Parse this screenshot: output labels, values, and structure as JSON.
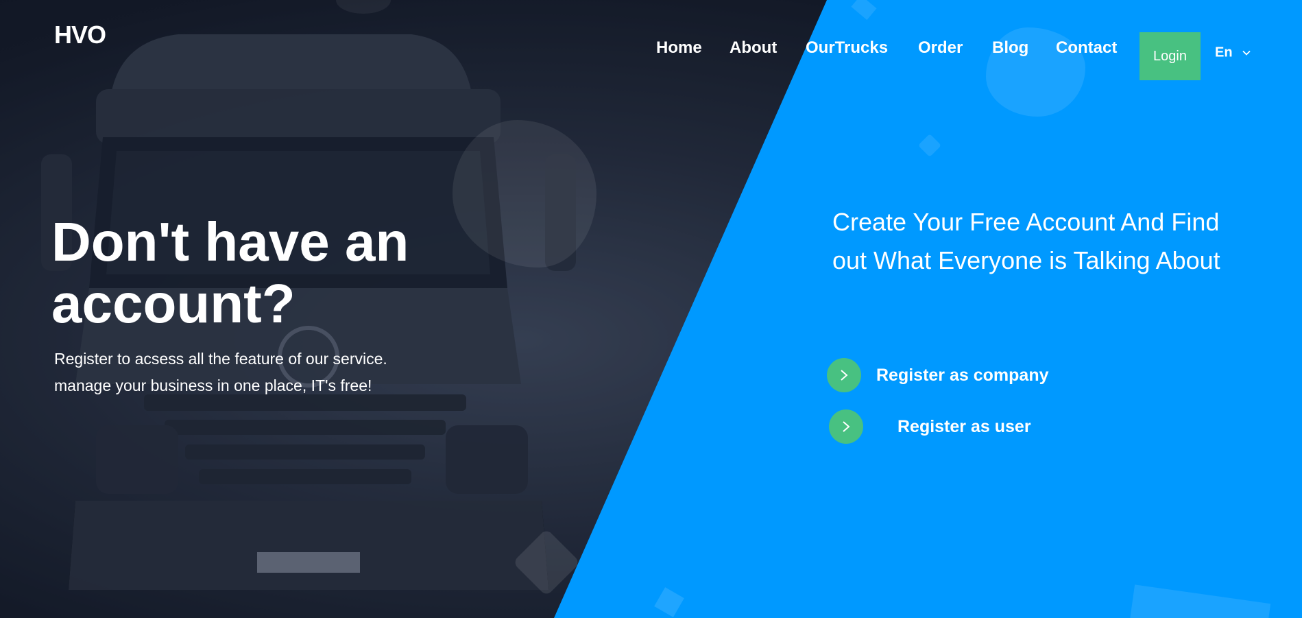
{
  "header": {
    "logo": "HVO",
    "nav": [
      {
        "label": "Home"
      },
      {
        "label": "About"
      },
      {
        "label": "OurTrucks"
      },
      {
        "label": "Order"
      },
      {
        "label": "Blog"
      },
      {
        "label": "Contact"
      }
    ],
    "login_label": "Login",
    "language": "En"
  },
  "hero": {
    "headline": "Don't have an account?",
    "subtext_lines": [
      "Register to acsess all the feature of our service.",
      "manage your business in one place, IT's free!"
    ],
    "tagline": "Create Your Free Account And Find out What Everyone is Talking About",
    "register_company_label": "Register as company",
    "register_user_label": "Register as user"
  },
  "colors": {
    "accent_blue": "#0099ff",
    "accent_green": "#48c181",
    "dark_bg": "#1a2030"
  },
  "icons": [
    "chevron-down-icon",
    "chevron-right-icon",
    "truck-image"
  ]
}
